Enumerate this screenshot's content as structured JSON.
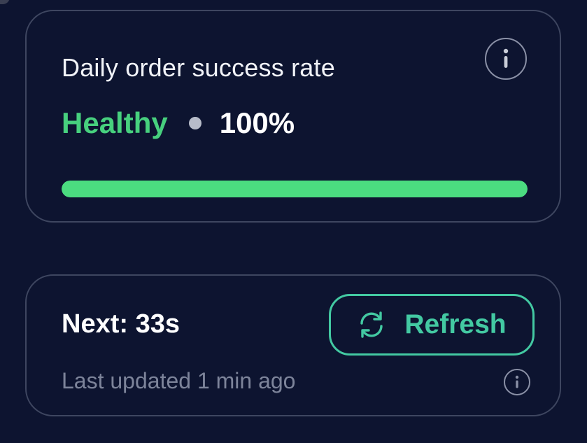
{
  "rate_card": {
    "title": "Daily order success rate",
    "status_label": "Healthy",
    "percent_text": "100%",
    "progress_fraction": 1.0,
    "info_icon": "info-icon"
  },
  "refresh_card": {
    "next_text": "Next: 33s",
    "refresh_label": "Refresh",
    "refresh_icon": "refresh-icon",
    "last_updated": "Last updated 1 min ago",
    "info_icon": "info-icon"
  },
  "colors": {
    "background": "#0d1430",
    "card_border": "#3e4660",
    "healthy_green": "#47d07e",
    "progress_green": "#4bdc80",
    "accent_teal": "#43c9a2",
    "muted_text": "#7d849a"
  }
}
